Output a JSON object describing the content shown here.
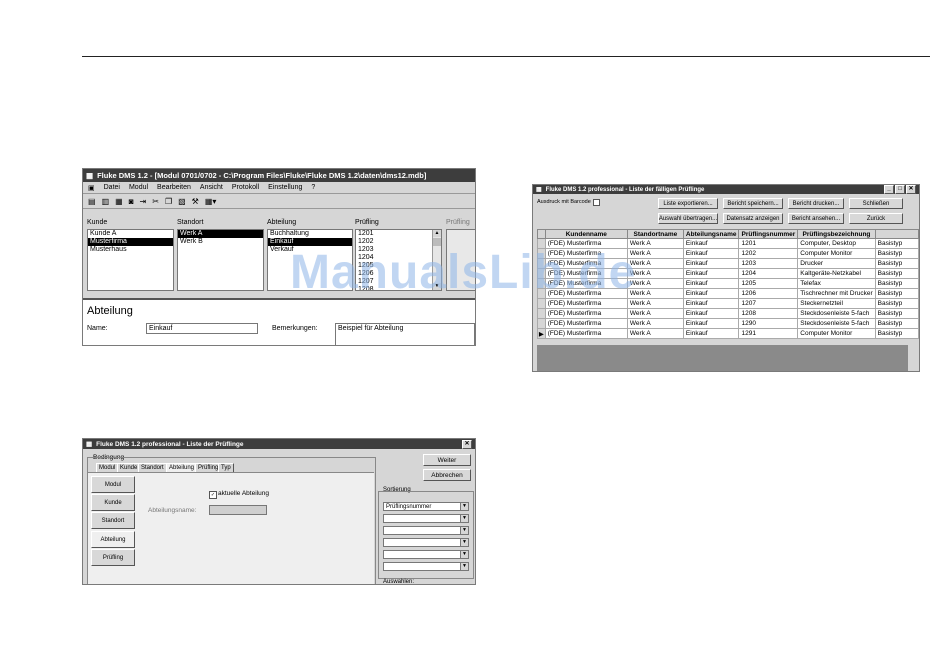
{
  "watermark": "ManualsLib.de",
  "win1": {
    "title": "Fluke DMS 1.2 - [Modul 0701/0702 - C:\\Program Files\\Fluke\\Fluke DMS 1.2\\daten\\dms12.mdb]",
    "menu": [
      "Datei",
      "Modul",
      "Bearbeiten",
      "Ansicht",
      "Protokoll",
      "Einstellung",
      "?"
    ],
    "columns": {
      "kunde": {
        "label": "Kunde",
        "items": [
          "Kunde A",
          "Musterfirma",
          "Musterhaus"
        ],
        "selected": 1
      },
      "standort": {
        "label": "Standort",
        "items": [
          "Werk A",
          "Werk B"
        ],
        "selected": 0
      },
      "abteilung": {
        "label": "Abteilung",
        "items": [
          "Buchhaltung",
          "Einkauf",
          "Verkauf"
        ],
        "selected": 1
      },
      "pruefling": {
        "label": "Prüfling",
        "items": [
          "1201",
          "1202",
          "1203",
          "1204",
          "1205",
          "1206",
          "1207",
          "1208"
        ]
      },
      "pruefling2": {
        "label": "Prüfling"
      }
    },
    "section_title": "Abteilung",
    "name_label": "Name:",
    "name_value": "Einkauf",
    "remarks_label": "Bemerkungen:",
    "remarks_value": "Beispiel für Abteilung"
  },
  "win2": {
    "title": "Fluke DMS 1.2 professional - Liste der Prüflinge",
    "group_label": "Bedingung",
    "tabs": [
      "Modul",
      "Kunde",
      "Standort",
      "Abteilung",
      "Prüfling",
      "Typ"
    ],
    "side_buttons": [
      "Modul",
      "Kunde",
      "Standort",
      "Abteilung",
      "Prüfling"
    ],
    "checkbox_label": "aktuelle Abteilung",
    "field_label": "Abteilungsname:",
    "weiter": "Weiter",
    "abbrechen": "Abbrechen",
    "sort_label": "Sortierung",
    "sort_first": "Prüflingsnummer",
    "bottom_label": "Auswahlen:"
  },
  "win3": {
    "title": "Fluke DMS 1.2 professional - Liste der fälligen Prüflinge",
    "barcode_label": "Ausdruck mit Barcode",
    "buttons": [
      "Liste exportieren...",
      "Bericht speichern...",
      "Bericht drucken...",
      "Schließen",
      "Auswahl übertragen...",
      "Datensatz anzeigen",
      "Bericht ansehen...",
      "Zurück"
    ],
    "headers": [
      "Kundenname",
      "Standortname",
      "Abteilungsname",
      "Prüflingsnummer",
      "Prüflingsbezeichnung",
      ""
    ],
    "rows": [
      [
        "(FDE) Musterfirma",
        "Werk A",
        "Einkauf",
        "1201",
        "Computer, Desktop",
        "Basistyp"
      ],
      [
        "(FDE) Musterfirma",
        "Werk A",
        "Einkauf",
        "1202",
        "Computer Monitor",
        "Basistyp"
      ],
      [
        "(FDE) Musterfirma",
        "Werk A",
        "Einkauf",
        "1203",
        "Drucker",
        "Basistyp"
      ],
      [
        "(FDE) Musterfirma",
        "Werk A",
        "Einkauf",
        "1204",
        "Kaltgeräte-Netzkabel",
        "Basistyp"
      ],
      [
        "(FDE) Musterfirma",
        "Werk A",
        "Einkauf",
        "1205",
        "Telefax",
        "Basistyp"
      ],
      [
        "(FDE) Musterfirma",
        "Werk A",
        "Einkauf",
        "1206",
        "Tischrechner mit Drucker",
        "Basistyp"
      ],
      [
        "(FDE) Musterfirma",
        "Werk A",
        "Einkauf",
        "1207",
        "Steckernetzteil",
        "Basistyp"
      ],
      [
        "(FDE) Musterfirma",
        "Werk A",
        "Einkauf",
        "1208",
        "Steckdosenleiste 5-fach",
        "Basistyp"
      ],
      [
        "(FDE) Musterfirma",
        "Werk A",
        "Einkauf",
        "1290",
        "Steckdosenleiste 5-fach",
        "Basistyp"
      ],
      [
        "(FDE) Musterfirma",
        "Werk A",
        "Einkauf",
        "1291",
        "Computer Monitor",
        "Basistyp"
      ]
    ]
  }
}
